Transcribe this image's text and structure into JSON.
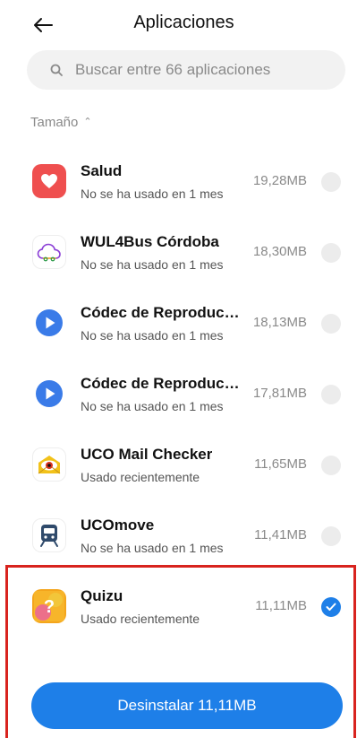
{
  "header": {
    "title": "Aplicaciones"
  },
  "search": {
    "placeholder": "Buscar entre 66 aplicaciones"
  },
  "sort": {
    "label": "Tamaño"
  },
  "apps": [
    {
      "name": "Salud",
      "status": "No se ha usado en 1 mes",
      "size": "19,28MB",
      "icon": "heart-icon",
      "selected": false
    },
    {
      "name": "WUL4Bus Córdoba",
      "status": "No se ha usado en 1 mes",
      "size": "18,30MB",
      "icon": "cloud-icon",
      "selected": false
    },
    {
      "name": "Códec de Reproduct...",
      "status": "No se ha usado en 1 mes",
      "size": "18,13MB",
      "icon": "play-icon",
      "selected": false
    },
    {
      "name": "Códec de Reproduct...",
      "status": "No se ha usado en 1 mes",
      "size": "17,81MB",
      "icon": "play-icon",
      "selected": false
    },
    {
      "name": "UCO Mail Checker",
      "status": "Usado recientemente",
      "size": "11,65MB",
      "icon": "mail-eye-icon",
      "selected": false
    },
    {
      "name": "UCOmove",
      "status": "No se ha usado en 1 mes",
      "size": "11,41MB",
      "icon": "train-icon",
      "selected": false
    },
    {
      "name": "Quizu",
      "status": "Usado recientemente",
      "size": "11,11MB",
      "icon": "question-bubble-icon",
      "selected": true
    }
  ],
  "footer": {
    "uninstall_label": "Desinstalar 11,11MB"
  },
  "colors": {
    "accent": "#1e7fe8",
    "highlight": "#d8231e"
  }
}
